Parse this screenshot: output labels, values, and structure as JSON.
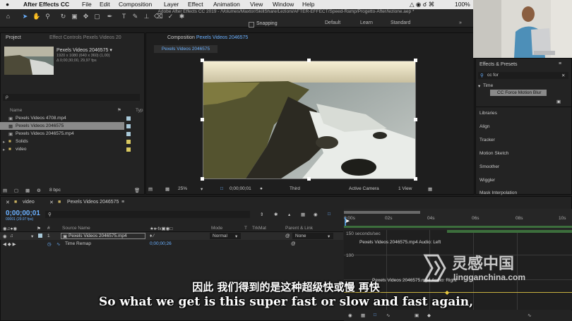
{
  "menubar": {
    "app": "After Effects CC",
    "items": [
      "File",
      "Edit",
      "Composition",
      "Layer",
      "Effect",
      "Animation",
      "View",
      "Window",
      "Help"
    ],
    "battery": "100%"
  },
  "window_title": "Adobe After Effects CC 2019 - /Volumes/Maxtor/SkillShare/Lezioni/AFTER-EFFECT/Speed-Ramp/Progetto-After/lezione.aep *",
  "toolbar": {
    "snapping": "Snapping",
    "workspaces": [
      "Default",
      "Learn",
      "Standard"
    ]
  },
  "project": {
    "tab": "Project",
    "effect_controls_tab": "Effect Controls Pexels Videos 20",
    "selected_name": "Pexels Videos 2046575 ▾",
    "selected_info1": "1920 x 1080  (640 x 360) (1,00)",
    "selected_info2": "Δ 0;00;30;00, 29,97 fps",
    "search_placeholder": "ρ",
    "col_name": "Name",
    "col_type": "Typ",
    "items": [
      {
        "name": "Pexels Videos 4708.mp4",
        "color": "#a8c8d8"
      },
      {
        "name": "Pexels Videos 2046575",
        "color": "#a8c8d8"
      },
      {
        "name": "Pexels Videos 2046575.mp4",
        "color": "#a8c8d8"
      },
      {
        "name": "Solids",
        "color": "#d8c860"
      },
      {
        "name": "video",
        "color": "#d8c860"
      }
    ],
    "bpc": "8 bpc"
  },
  "composition": {
    "tab": "Composition",
    "tab_name": "Pexels Videos 2046575",
    "subtab": "Pexels Videos 2046575",
    "zoom": "25%",
    "timecode": "0;00;00;01",
    "view": "Third",
    "camera": "Active Camera",
    "views": "1 View"
  },
  "effects": {
    "tab": "Effects & Presets",
    "search": "cc for",
    "category": "Time",
    "result": "CC Force Motion Blur",
    "panels": [
      "Libraries",
      "Align",
      "Tracker",
      "Motion Sketch",
      "Smoother",
      "Wiggler",
      "Mask Interpolation"
    ]
  },
  "timeline": {
    "tab_video": "video",
    "tab_comp": "Pexels Videos 2046575",
    "timecode": "0;00;00;01",
    "fps": "00001 (29.97 fps)",
    "col_source": "Source Name",
    "col_mode": "Mode",
    "col_t": "T",
    "col_trkmat": "TrkMat",
    "col_parent": "Parent & Link",
    "layer_index": "1",
    "layer_name": "Pexels Videos 2046575.mp4",
    "layer_mode": "Normal",
    "layer_parent": "None",
    "prop_name": "Time Remap",
    "prop_value": "0;00;00;26",
    "ruler": [
      "0:00s",
      "02s",
      "04s",
      "06s",
      "08s",
      "10s"
    ],
    "graph_unit": "150 seconds/sec",
    "graph_label1": "Pexels Videos 2046575.mp4 Audio: Left",
    "graph_label2": "Pexels Videos 2046575.mp4 Audio: Right",
    "graph_y": "100"
  },
  "subtitles": {
    "cn": "因此 我们得到的是这种超级快或慢 再快",
    "en": "So what we get is this super fast or slow and fast again,"
  },
  "watermark": {
    "cn": "灵感中国",
    "url": "lingganchina.com"
  }
}
